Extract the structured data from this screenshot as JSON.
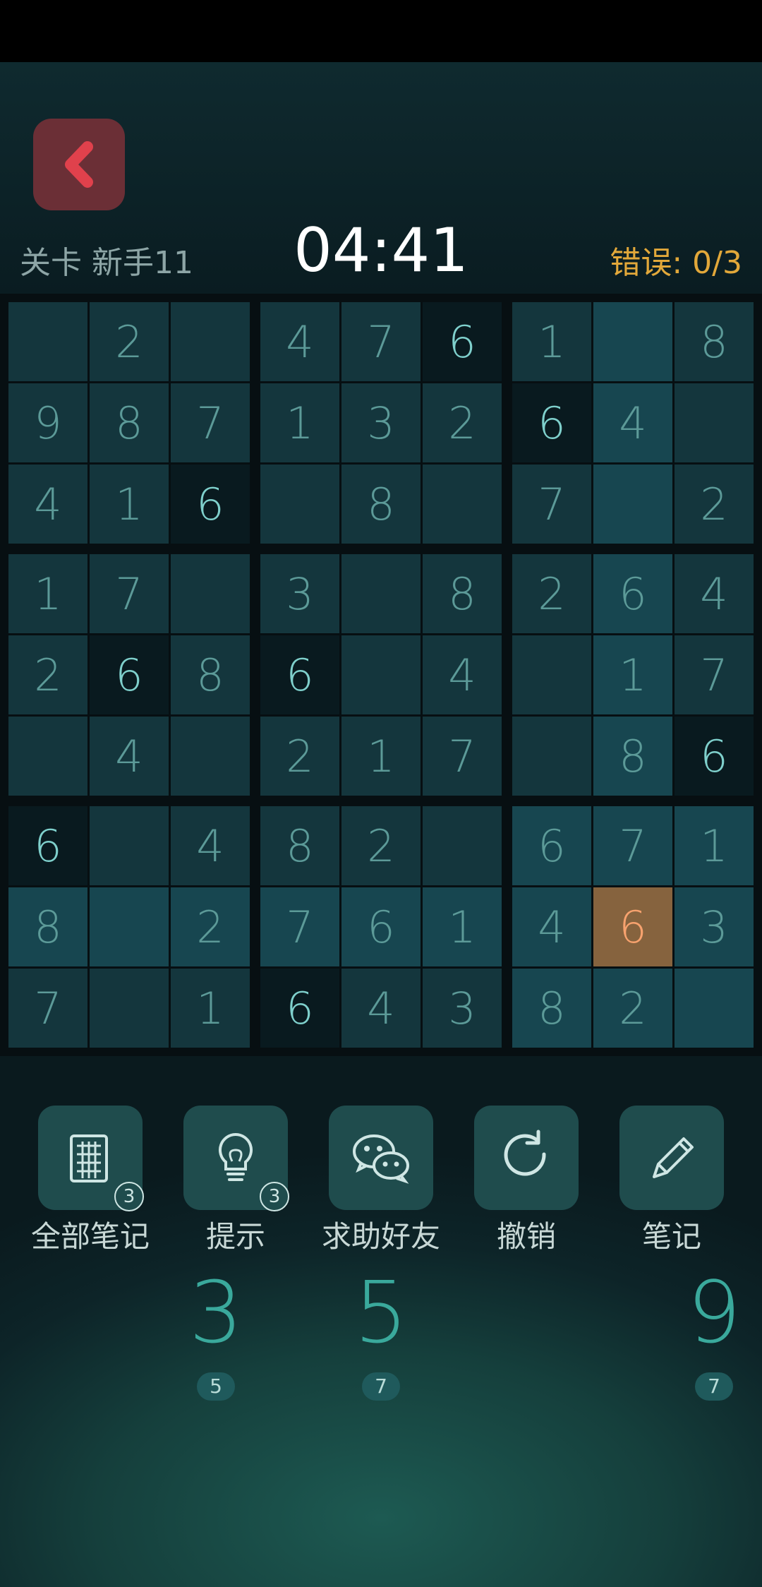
{
  "header": {
    "level_label": "关卡 新手11",
    "timer": "04:41",
    "errors_label": "错误: 0/3"
  },
  "board": {
    "rows": [
      [
        "",
        "2",
        "",
        "4",
        "7",
        "6",
        "1",
        "",
        "8"
      ],
      [
        "9",
        "8",
        "7",
        "1",
        "3",
        "2",
        "6",
        "4",
        ""
      ],
      [
        "4",
        "1",
        "6",
        "",
        "8",
        "",
        "7",
        "",
        "2"
      ],
      [
        "1",
        "7",
        "",
        "3",
        "",
        "8",
        "2",
        "6",
        "4"
      ],
      [
        "2",
        "6",
        "8",
        "6",
        "",
        "4",
        "",
        "1",
        "7"
      ],
      [
        "",
        "4",
        "",
        "2",
        "1",
        "7",
        "",
        "8",
        "6"
      ],
      [
        "6",
        "",
        "4",
        "8",
        "2",
        "",
        "6",
        "7",
        "1"
      ],
      [
        "8",
        "",
        "2",
        "7",
        "6",
        "1",
        "4",
        "6",
        "3"
      ],
      [
        "7",
        "",
        "1",
        "6",
        "4",
        "3",
        "8",
        "2",
        ""
      ]
    ],
    "selected_cell": {
      "row": 7,
      "col": 7,
      "value": "6"
    }
  },
  "tools": [
    {
      "label": "全部笔记",
      "icon": "notes-grid-icon",
      "badge": "3"
    },
    {
      "label": "提示",
      "icon": "lightbulb-icon",
      "badge": "3"
    },
    {
      "label": "求助好友",
      "icon": "wechat-icon",
      "badge": ""
    },
    {
      "label": "撤销",
      "icon": "undo-icon",
      "badge": ""
    },
    {
      "label": "笔记",
      "icon": "pencil-icon",
      "badge": ""
    }
  ],
  "numpad": [
    {
      "digit": "3",
      "remaining": "5"
    },
    {
      "digit": "5",
      "remaining": "7"
    },
    {
      "digit": "9",
      "remaining": "7"
    }
  ],
  "colors": {
    "accent": "#3aa99c",
    "error": "#e2a83a",
    "back_button": "#6b2f36",
    "selected_cell": "#86633e"
  }
}
